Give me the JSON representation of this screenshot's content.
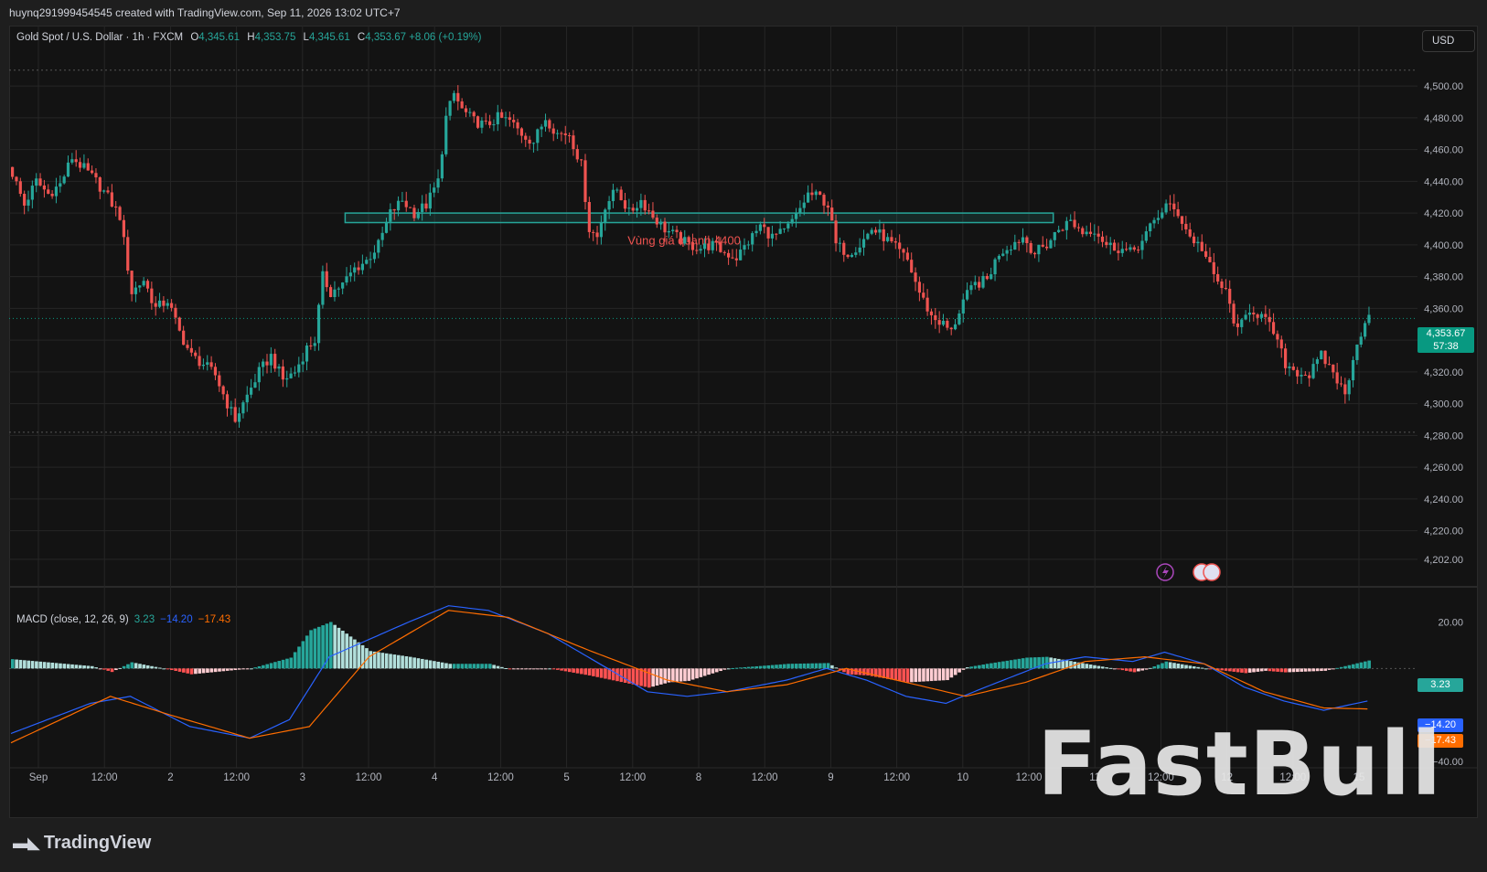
{
  "header": {
    "created_by": "huynq291999454545 created with TradingView.com, Sep 11, 2026 13:02 UTC+7"
  },
  "legend": {
    "symbol": "Gold Spot / U.S. Dollar · 1h · FXCM",
    "o_label": "O",
    "o": "4,345.61",
    "h_label": "H",
    "h": "4,353.75",
    "l_label": "L",
    "l": "4,345.61",
    "c_label": "C",
    "c": "4,353.67",
    "change": "+8.06 (+0.19%)"
  },
  "currency_button": "USD",
  "price_tag": {
    "price": "4,353.67",
    "countdown": "57:38"
  },
  "macd": {
    "label": "MACD (close, 12, 26, 9)",
    "hist": "3.23",
    "macd": "−14.20",
    "signal": "−17.43",
    "axis_labels": [
      "20.00",
      "−40.00"
    ]
  },
  "annotation": {
    "zone_label": "Vùng giá quanh 4400"
  },
  "watermark": "FastBull",
  "footer": {
    "brand": "TradingView"
  },
  "colors": {
    "up": "#26a69a",
    "down": "#ef5350",
    "macd": "#2962ff",
    "signal": "#ff6d00",
    "bg": "#131313"
  },
  "chart_data": {
    "type": "candlestick",
    "interval": "1h",
    "y_ticks": [
      4202,
      4220,
      4240,
      4260,
      4280,
      4300,
      4320,
      4340,
      4360,
      4380,
      4400,
      4420,
      4440,
      4460,
      4480,
      4500
    ],
    "y_tick_labels": [
      "4,202.00",
      "4,220.00",
      "4,240.00",
      "4,260.00",
      "4,280.00",
      "4,300.00",
      "4,320.00",
      "4,340.00",
      "4,360.00",
      "4,380.00",
      "4,400.00",
      "4,420.00",
      "4,440.00",
      "4,460.00",
      "4,480.00",
      "4,500.00"
    ],
    "ylim": [
      4187,
      4515
    ],
    "x_labels": [
      "Sep",
      "12:00",
      "2",
      "12:00",
      "3",
      "12:00",
      "4",
      "12:00",
      "5",
      "12:00",
      "8",
      "12:00",
      "9",
      "12:00",
      "10",
      "12:00",
      "11",
      "12:00",
      "12",
      "12:00",
      "15"
    ],
    "zone": {
      "low": 4414,
      "high": 4420,
      "label": "Vùng giá quanh 4400"
    },
    "dotted_levels": [
      4510,
      4282
    ],
    "last_price": 4353.67,
    "close_path": [
      [
        0,
        4445
      ],
      [
        3,
        4425
      ],
      [
        6,
        4440
      ],
      [
        9,
        4432
      ],
      [
        12,
        4438
      ],
      [
        15,
        4455
      ],
      [
        18,
        4448
      ],
      [
        21,
        4440
      ],
      [
        24,
        4430
      ],
      [
        27,
        4418
      ],
      [
        30,
        4370
      ],
      [
        33,
        4378
      ],
      [
        36,
        4360
      ],
      [
        39,
        4365
      ],
      [
        42,
        4345
      ],
      [
        45,
        4330
      ],
      [
        48,
        4325
      ],
      [
        51,
        4318
      ],
      [
        54,
        4300
      ],
      [
        56,
        4290
      ],
      [
        59,
        4305
      ],
      [
        62,
        4320
      ],
      [
        65,
        4330
      ],
      [
        68,
        4315
      ],
      [
        71,
        4320
      ],
      [
        74,
        4335
      ],
      [
        76,
        4340
      ],
      [
        78,
        4380
      ],
      [
        80,
        4370
      ],
      [
        83,
        4375
      ],
      [
        86,
        4385
      ],
      [
        89,
        4390
      ],
      [
        92,
        4400
      ],
      [
        95,
        4420
      ],
      [
        98,
        4428
      ],
      [
        101,
        4420
      ],
      [
        104,
        4425
      ],
      [
        107,
        4440
      ],
      [
        109,
        4480
      ],
      [
        111,
        4495
      ],
      [
        113,
        4485
      ],
      [
        116,
        4478
      ],
      [
        119,
        4475
      ],
      [
        122,
        4480
      ],
      [
        125,
        4478
      ],
      [
        128,
        4470
      ],
      [
        131,
        4465
      ],
      [
        134,
        4480
      ],
      [
        137,
        4470
      ],
      [
        140,
        4470
      ],
      [
        143,
        4450
      ],
      [
        145,
        4410
      ],
      [
        147,
        4405
      ],
      [
        149,
        4425
      ],
      [
        152,
        4435
      ],
      [
        155,
        4420
      ],
      [
        158,
        4428
      ],
      [
        161,
        4418
      ],
      [
        164,
        4410
      ],
      [
        167,
        4405
      ],
      [
        170,
        4400
      ],
      [
        173,
        4398
      ],
      [
        176,
        4400
      ],
      [
        179,
        4395
      ],
      [
        182,
        4392
      ],
      [
        185,
        4402
      ],
      [
        188,
        4412
      ],
      [
        191,
        4405
      ],
      [
        194,
        4408
      ],
      [
        197,
        4418
      ],
      [
        200,
        4432
      ],
      [
        203,
        4430
      ],
      [
        205,
        4425
      ],
      [
        207,
        4400
      ],
      [
        210,
        4395
      ],
      [
        213,
        4400
      ],
      [
        216,
        4410
      ],
      [
        219,
        4405
      ],
      [
        222,
        4398
      ],
      [
        225,
        4390
      ],
      [
        228,
        4370
      ],
      [
        231,
        4355
      ],
      [
        234,
        4350
      ],
      [
        236,
        4345
      ],
      [
        239,
        4365
      ],
      [
        242,
        4375
      ],
      [
        245,
        4378
      ],
      [
        248,
        4395
      ],
      [
        251,
        4400
      ],
      [
        254,
        4405
      ],
      [
        257,
        4395
      ],
      [
        260,
        4400
      ],
      [
        263,
        4410
      ],
      [
        266,
        4415
      ],
      [
        269,
        4408
      ],
      [
        272,
        4410
      ],
      [
        275,
        4400
      ],
      [
        278,
        4398
      ],
      [
        281,
        4395
      ],
      [
        284,
        4402
      ],
      [
        287,
        4415
      ],
      [
        290,
        4425
      ],
      [
        293,
        4420
      ],
      [
        296,
        4405
      ],
      [
        299,
        4398
      ],
      [
        302,
        4380
      ],
      [
        305,
        4370
      ],
      [
        308,
        4345
      ],
      [
        311,
        4360
      ],
      [
        314,
        4355
      ],
      [
        317,
        4345
      ],
      [
        320,
        4325
      ],
      [
        323,
        4320
      ],
      [
        326,
        4318
      ],
      [
        329,
        4330
      ],
      [
        332,
        4320
      ],
      [
        335,
        4305
      ],
      [
        337,
        4330
      ],
      [
        339,
        4345
      ],
      [
        341,
        4353.67
      ]
    ],
    "macd": {
      "axis": [
        20,
        -40
      ],
      "ylim": [
        -40,
        32
      ],
      "hist_last": 3.23,
      "macd_last": -14.2,
      "signal_last": -17.43,
      "macd_path": [
        [
          0,
          -28
        ],
        [
          20,
          -15
        ],
        [
          30,
          -12
        ],
        [
          45,
          -25
        ],
        [
          60,
          -30
        ],
        [
          70,
          -22
        ],
        [
          80,
          5
        ],
        [
          100,
          20
        ],
        [
          110,
          27
        ],
        [
          120,
          25
        ],
        [
          135,
          15
        ],
        [
          150,
          0
        ],
        [
          160,
          -10
        ],
        [
          170,
          -12
        ],
        [
          180,
          -10
        ],
        [
          195,
          -5
        ],
        [
          205,
          0
        ],
        [
          215,
          -5
        ],
        [
          225,
          -12
        ],
        [
          235,
          -15
        ],
        [
          245,
          -8
        ],
        [
          260,
          2
        ],
        [
          270,
          5
        ],
        [
          282,
          3
        ],
        [
          290,
          7
        ],
        [
          300,
          2
        ],
        [
          310,
          -8
        ],
        [
          320,
          -14
        ],
        [
          330,
          -18
        ],
        [
          341,
          -14
        ]
      ],
      "signal_path": [
        [
          0,
          -32
        ],
        [
          25,
          -12
        ],
        [
          40,
          -20
        ],
        [
          60,
          -30
        ],
        [
          75,
          -25
        ],
        [
          90,
          5
        ],
        [
          110,
          25
        ],
        [
          125,
          22
        ],
        [
          145,
          8
        ],
        [
          165,
          -5
        ],
        [
          180,
          -10
        ],
        [
          195,
          -7
        ],
        [
          210,
          0
        ],
        [
          225,
          -6
        ],
        [
          240,
          -12
        ],
        [
          255,
          -6
        ],
        [
          270,
          3
        ],
        [
          285,
          5
        ],
        [
          300,
          2
        ],
        [
          315,
          -10
        ],
        [
          330,
          -17
        ],
        [
          341,
          -17.43
        ]
      ]
    }
  }
}
